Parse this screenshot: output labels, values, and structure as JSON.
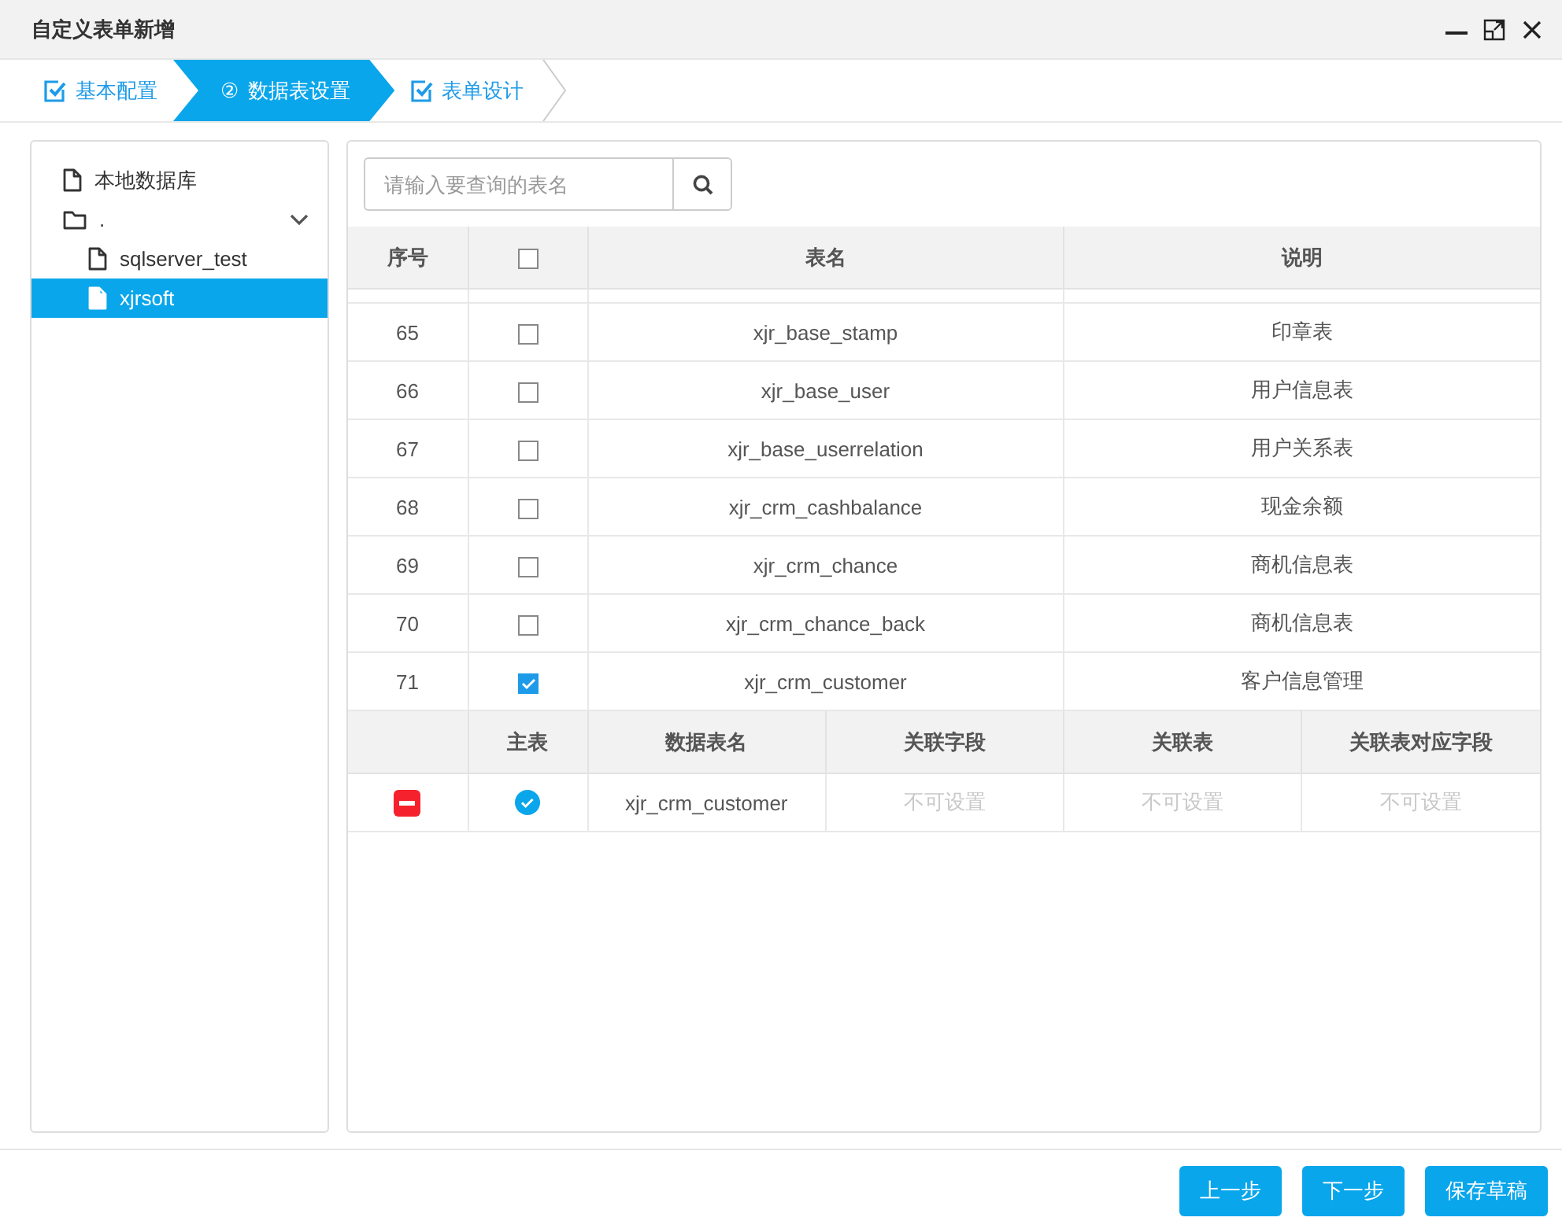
{
  "window": {
    "title": "自定义表单新增"
  },
  "steps": [
    {
      "label": "基本配置",
      "kind": "check",
      "selected": false
    },
    {
      "label": "数据表设置",
      "kind": "number",
      "number": "②",
      "selected": true
    },
    {
      "label": "表单设计",
      "kind": "check",
      "selected": false
    }
  ],
  "tree": [
    {
      "label": "本地数据库",
      "kind": "file",
      "selected": false
    },
    {
      "label": ".",
      "kind": "folder",
      "selected": false,
      "expanded": true,
      "children": [
        {
          "label": "sqlserver_test",
          "kind": "file",
          "selected": false
        },
        {
          "label": "xjrsoft",
          "kind": "file",
          "selected": true
        }
      ]
    }
  ],
  "search": {
    "placeholder": "请输入要查询的表名"
  },
  "table": {
    "columns": [
      "序号",
      "表名",
      "说明"
    ],
    "all_checked": false,
    "rows": [
      {
        "index": "65",
        "checked": false,
        "name": "xjr_base_stamp",
        "description": "印章表"
      },
      {
        "index": "66",
        "checked": false,
        "name": "xjr_base_user",
        "description": "用户信息表"
      },
      {
        "index": "67",
        "checked": false,
        "name": "xjr_base_userrelation",
        "description": "用户关系表"
      },
      {
        "index": "68",
        "checked": false,
        "name": "xjr_crm_cashbalance",
        "description": "现金余额"
      },
      {
        "index": "69",
        "checked": false,
        "name": "xjr_crm_chance",
        "description": "商机信息表"
      },
      {
        "index": "70",
        "checked": false,
        "name": "xjr_crm_chance_back",
        "description": "商机信息表"
      },
      {
        "index": "71",
        "checked": true,
        "name": "xjr_crm_customer",
        "description": "客户信息管理"
      }
    ]
  },
  "relations": {
    "columns": [
      "主表",
      "数据表名",
      "关联字段",
      "关联表",
      "关联表对应字段"
    ],
    "rows": [
      {
        "main": true,
        "name": "xjr_crm_customer",
        "field": "不可设置",
        "table": "不可设置",
        "target_field": "不可设置",
        "disabled": true
      }
    ]
  },
  "buttons": [
    "上一步",
    "下一步",
    "保存草稿"
  ]
}
